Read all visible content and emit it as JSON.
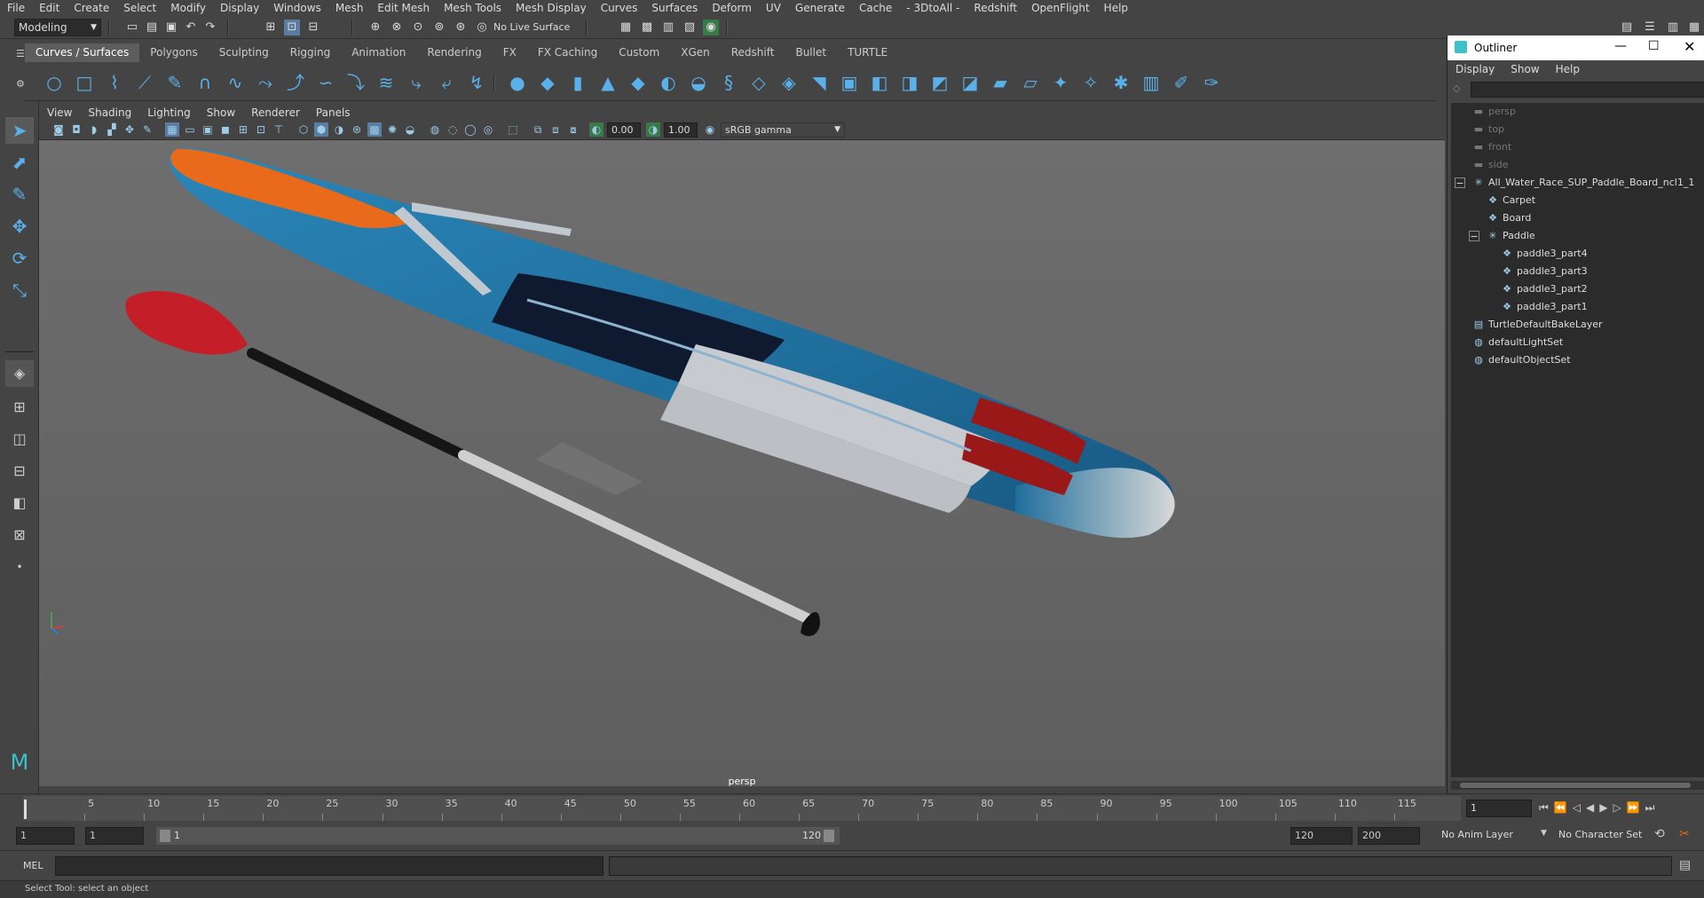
{
  "menubar": [
    "File",
    "Edit",
    "Create",
    "Select",
    "Modify",
    "Display",
    "Windows",
    "Mesh",
    "Edit Mesh",
    "Mesh Tools",
    "Mesh Display",
    "Curves",
    "Surfaces",
    "Deform",
    "UV",
    "Generate",
    "Cache",
    "- 3DtoAll -",
    "Redshift",
    "OpenFlight",
    "Help"
  ],
  "status": {
    "workspace": "Modeling",
    "live_surface": "No Live Surface"
  },
  "shelf_tabs": [
    "Curves / Surfaces",
    "Polygons",
    "Sculpting",
    "Rigging",
    "Animation",
    "Rendering",
    "FX",
    "FX Caching",
    "Custom",
    "XGen",
    "Redshift",
    "Bullet",
    "TURTLE"
  ],
  "shelf_active": "Curves / Surfaces",
  "view_menu": [
    "View",
    "Shading",
    "Lighting",
    "Show",
    "Renderer",
    "Panels"
  ],
  "view_tools": {
    "exposure": "0.00",
    "gamma": "1.00",
    "colorspace": "sRGB gamma"
  },
  "viewport": {
    "camera_label": "persp"
  },
  "outliner": {
    "title": "Outliner",
    "menu": [
      "Display",
      "Show",
      "Help"
    ],
    "items": [
      {
        "label": "persp",
        "icon": "camera-icon",
        "depth": 0,
        "dim": true
      },
      {
        "label": "top",
        "icon": "camera-icon",
        "depth": 0,
        "dim": true
      },
      {
        "label": "front",
        "icon": "camera-icon",
        "depth": 0,
        "dim": true
      },
      {
        "label": "side",
        "icon": "camera-icon",
        "depth": 0,
        "dim": true
      },
      {
        "label": "All_Water_Race_SUP_Paddle_Board_ncl1_1",
        "icon": "group-icon",
        "depth": 0,
        "dim": false,
        "expand": "−"
      },
      {
        "label": "Carpet",
        "icon": "mesh-icon",
        "depth": 1,
        "dim": false
      },
      {
        "label": "Board",
        "icon": "mesh-icon",
        "depth": 1,
        "dim": false
      },
      {
        "label": "Paddle",
        "icon": "group-icon",
        "depth": 1,
        "dim": false,
        "expand": "−"
      },
      {
        "label": "paddle3_part4",
        "icon": "mesh-icon",
        "depth": 2,
        "dim": false
      },
      {
        "label": "paddle3_part3",
        "icon": "mesh-icon",
        "depth": 2,
        "dim": false
      },
      {
        "label": "paddle3_part2",
        "icon": "mesh-icon",
        "depth": 2,
        "dim": false
      },
      {
        "label": "paddle3_part1",
        "icon": "mesh-icon",
        "depth": 2,
        "dim": false
      },
      {
        "label": "TurtleDefaultBakeLayer",
        "icon": "layer-icon",
        "depth": 0,
        "dim": false
      },
      {
        "label": "defaultLightSet",
        "icon": "set-icon",
        "depth": 0,
        "dim": false
      },
      {
        "label": "defaultObjectSet",
        "icon": "set-icon",
        "depth": 0,
        "dim": false
      }
    ]
  },
  "timeline": {
    "ticks": [
      "5",
      "10",
      "15",
      "20",
      "25",
      "30",
      "35",
      "40",
      "45",
      "50",
      "55",
      "60",
      "65",
      "70",
      "75",
      "80",
      "85",
      "90",
      "95",
      "100",
      "105",
      "110",
      "115"
    ],
    "current_frame": "1"
  },
  "range": {
    "start": "1",
    "playback_start": "1",
    "slider_start": "1",
    "slider_end": "120",
    "playback_end": "120",
    "end": "200",
    "anim_layer": "No Anim Layer",
    "char_set": "No Character Set"
  },
  "command": {
    "label": "MEL"
  },
  "help_line": "Select Tool: select an object",
  "colors": {
    "accent": "#5ab0e8",
    "board_blue": "#1f6e9c",
    "paddle_red": "#c41e28",
    "bg_viewport": "#6a6a6a"
  }
}
